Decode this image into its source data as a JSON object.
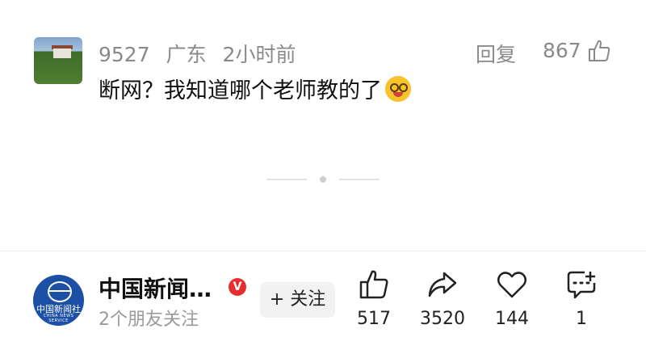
{
  "comment": {
    "user": "9527",
    "location": "广东",
    "time": "2小时前",
    "reply_label": "回复",
    "like_count": "867",
    "text": "断网？我知道哪个老师教的了",
    "emoji": "smirking-glasses-emoji"
  },
  "account": {
    "name": "中国新闻…",
    "logo_cn": "中国新闻社",
    "logo_en": "CHINA NEWS SERVICE",
    "verified_badge": "V",
    "friends": "2个朋友关注",
    "follow_label": "+ 关注"
  },
  "actions": {
    "like": {
      "icon": "thumbs-up-icon",
      "count": "517"
    },
    "share": {
      "icon": "share-arrow-icon",
      "count": "3520"
    },
    "favorite": {
      "icon": "heart-icon",
      "count": "144"
    },
    "comment": {
      "icon": "comment-add-icon",
      "count": "1"
    }
  },
  "colors": {
    "muted": "#8a8a8a",
    "verified": "#e62e2e",
    "logo_bg": "#1c4fa6"
  }
}
